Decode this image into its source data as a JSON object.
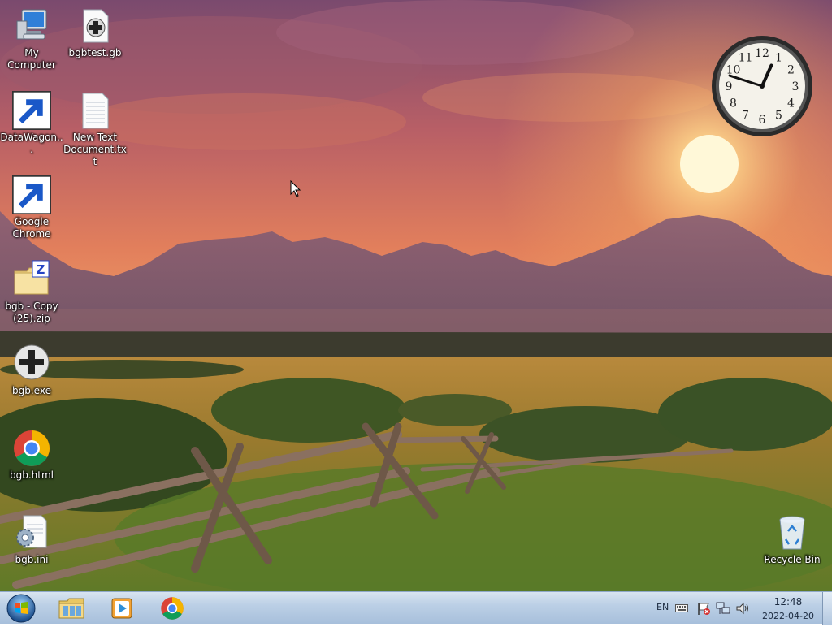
{
  "desktop": {
    "icons": [
      {
        "label": "My Computer",
        "icon": "computer-icon"
      },
      {
        "label": "bgbtest.gb",
        "icon": "gameboy-file-icon"
      },
      {
        "label": "DataWagon...",
        "icon": "datawagon-icon"
      },
      {
        "label": "New Text Document.txt",
        "icon": "text-document-icon"
      },
      {
        "label": "Google Chrome",
        "icon": "chrome-icon"
      },
      {
        "label": "bgb - Copy (25).zip",
        "icon": "zip-folder-icon"
      },
      {
        "label": "bgb.exe",
        "icon": "gamepad-icon"
      },
      {
        "label": "bgb.html",
        "icon": "chrome-html-icon"
      },
      {
        "label": "bgb.ini",
        "icon": "settings-file-icon"
      },
      {
        "label": "Recycle Bin",
        "icon": "recycle-bin-icon"
      }
    ]
  },
  "gadget": {
    "clock": {
      "hour": 12,
      "minute": 48,
      "numerals": [
        "12",
        "1",
        "2",
        "3",
        "4",
        "5",
        "6",
        "7",
        "8",
        "9",
        "10",
        "11"
      ]
    }
  },
  "taskbar": {
    "pinned": [
      {
        "name": "File Explorer",
        "icon": "folder-icon"
      },
      {
        "name": "Media Player",
        "icon": "media-player-icon"
      },
      {
        "name": "Google Chrome",
        "icon": "chrome-icon"
      }
    ],
    "tray": {
      "language": "EN",
      "time": "12:48",
      "date": "2022-04-20"
    }
  },
  "colors": {
    "taskbar_top": "#d8e4f0",
    "taskbar_bottom": "#a7bfdb",
    "sky_top": "#7a4a6e",
    "sky_glow": "#f5a05a",
    "sun": "#fff4c8"
  }
}
